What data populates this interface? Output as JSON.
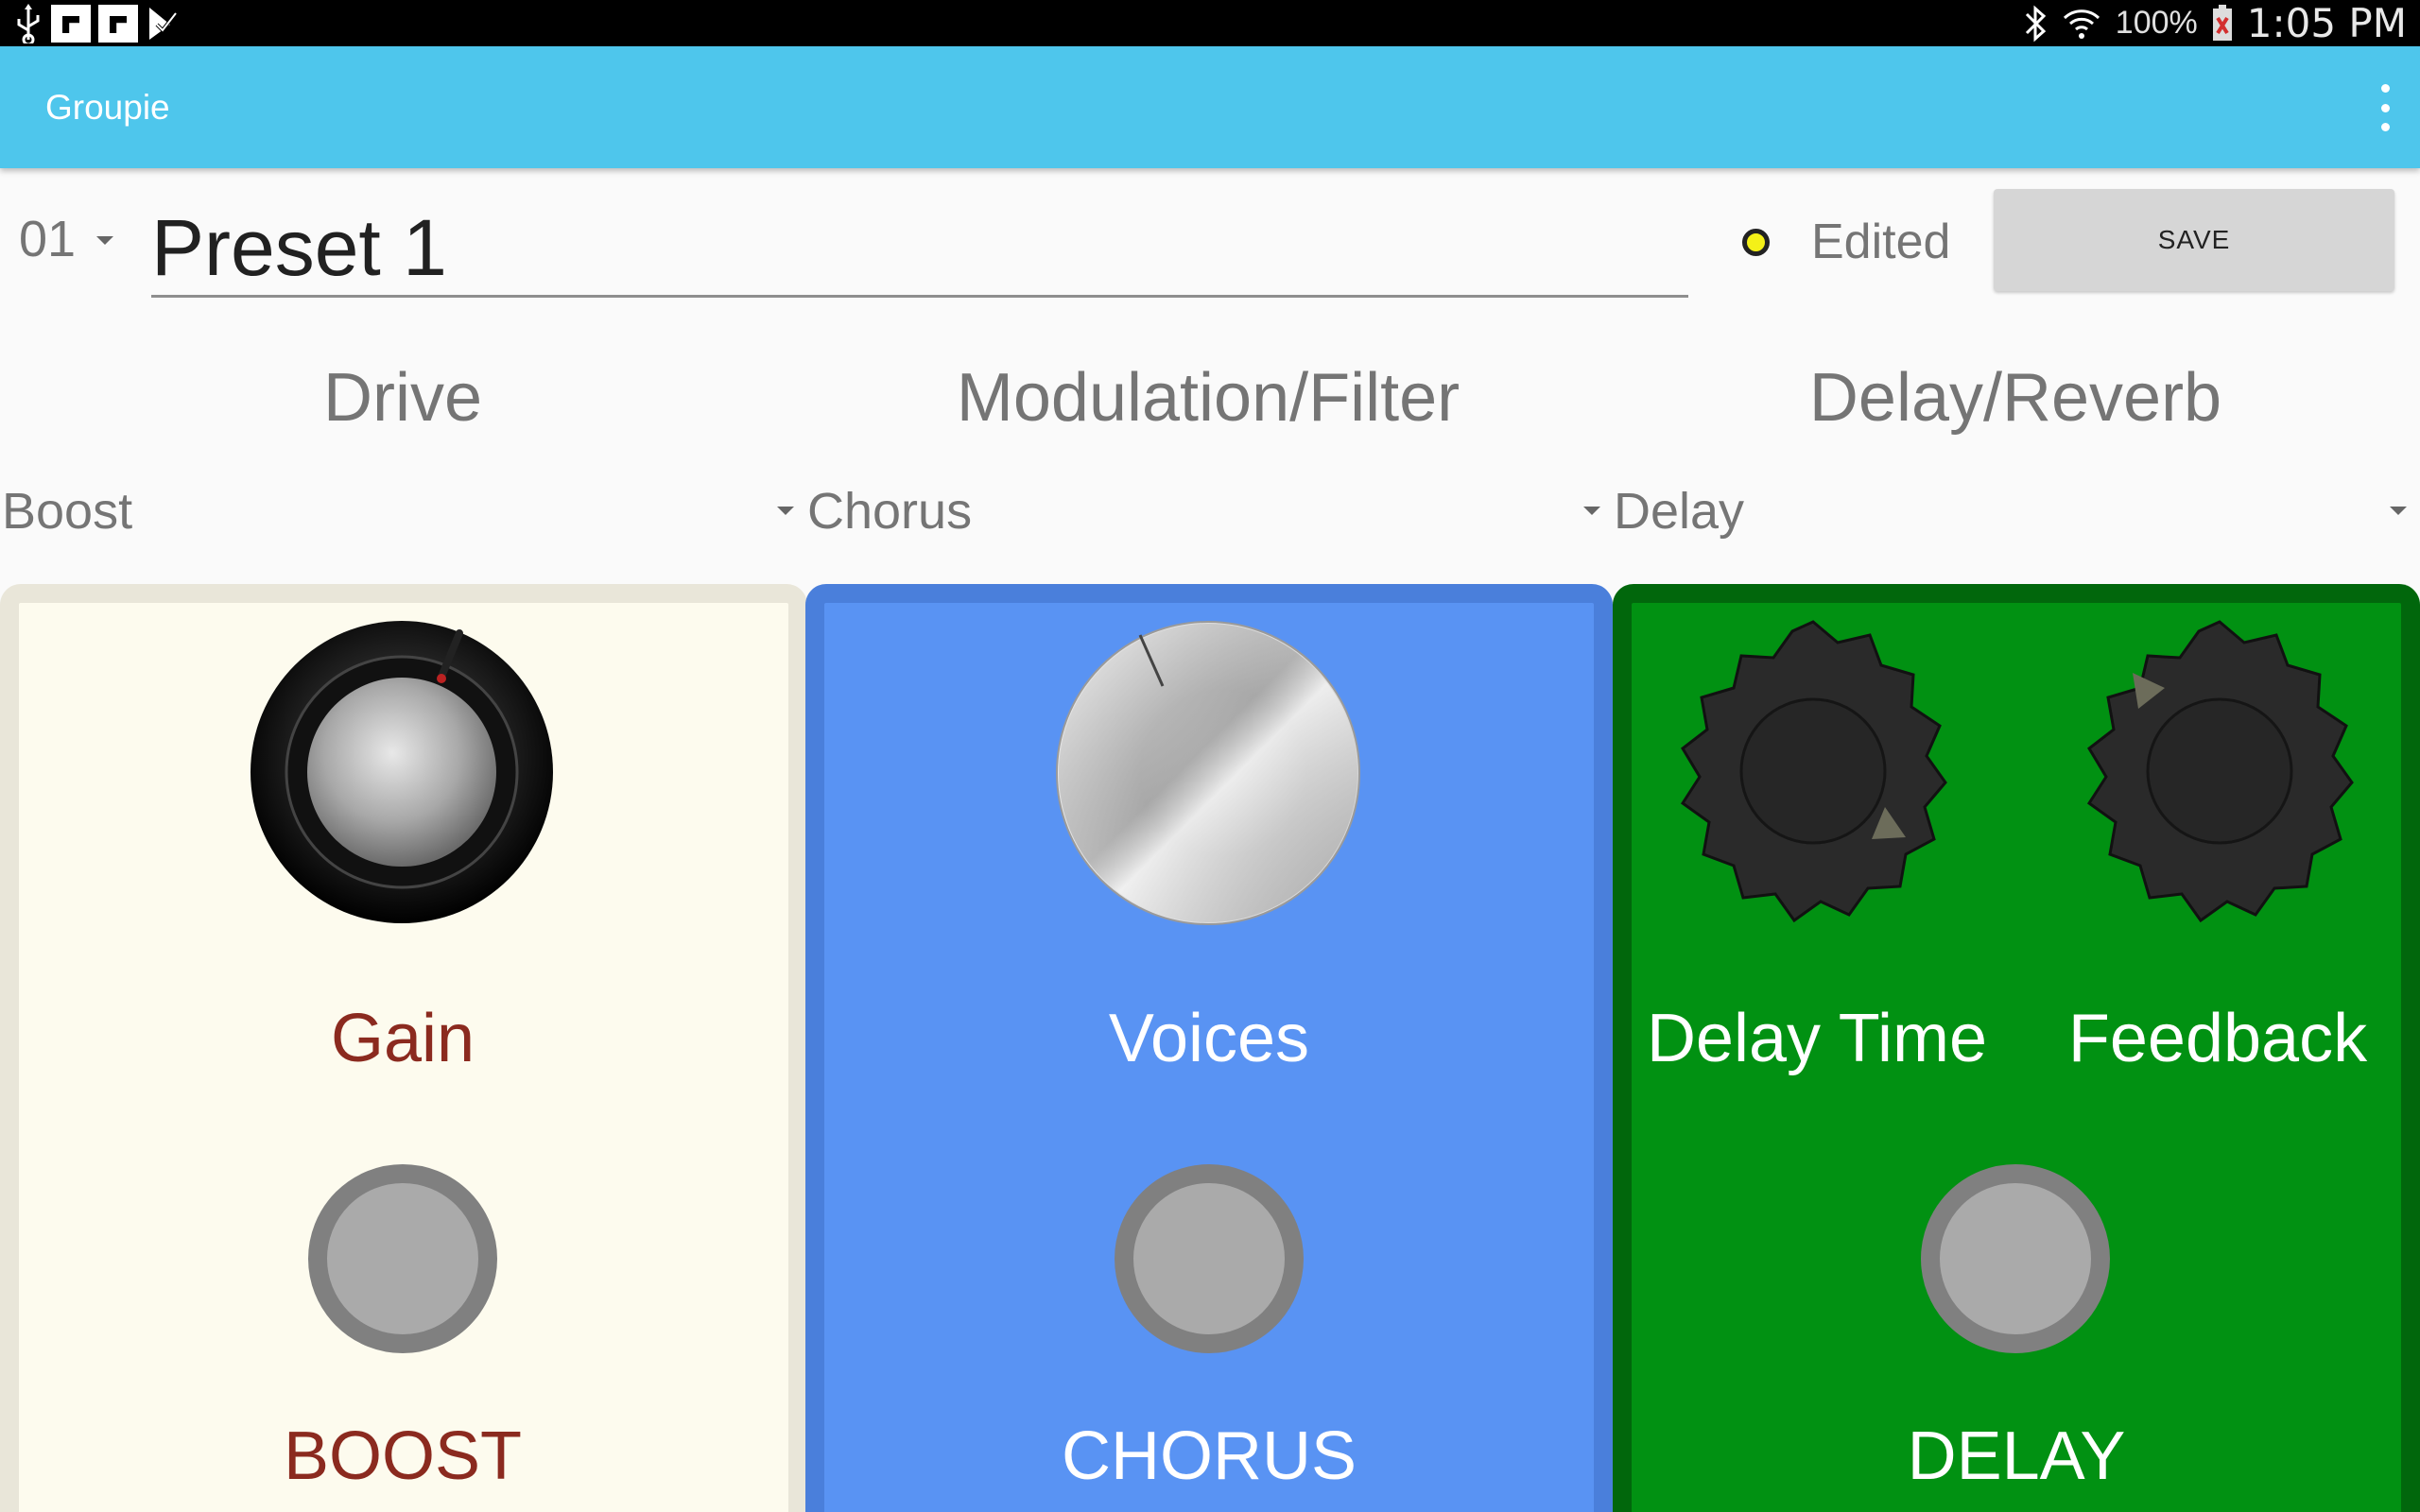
{
  "status_bar": {
    "battery": "100%",
    "time": "1:05 PM"
  },
  "app_bar": {
    "title": "Groupie"
  },
  "preset": {
    "number": "01",
    "name": "Preset 1",
    "status": "Edited",
    "save_label": "SAVE"
  },
  "columns": [
    {
      "heading": "Drive",
      "effect": "Boost",
      "knobs": [
        "Gain"
      ],
      "pedal_label": "BOOST",
      "color": "#fdfbee",
      "text_color": "#8b2a1f"
    },
    {
      "heading": "Modulation/Filter",
      "effect": "Chorus",
      "knobs": [
        "Voices"
      ],
      "pedal_label": "CHORUS",
      "color": "#5993f3",
      "text_color": "#ffffff"
    },
    {
      "heading": "Delay/Reverb",
      "effect": "Delay",
      "knobs": [
        "Delay Time",
        "Feedback"
      ],
      "pedal_label": "DELAY",
      "color": "#019112",
      "text_color": "#ffffff"
    }
  ]
}
